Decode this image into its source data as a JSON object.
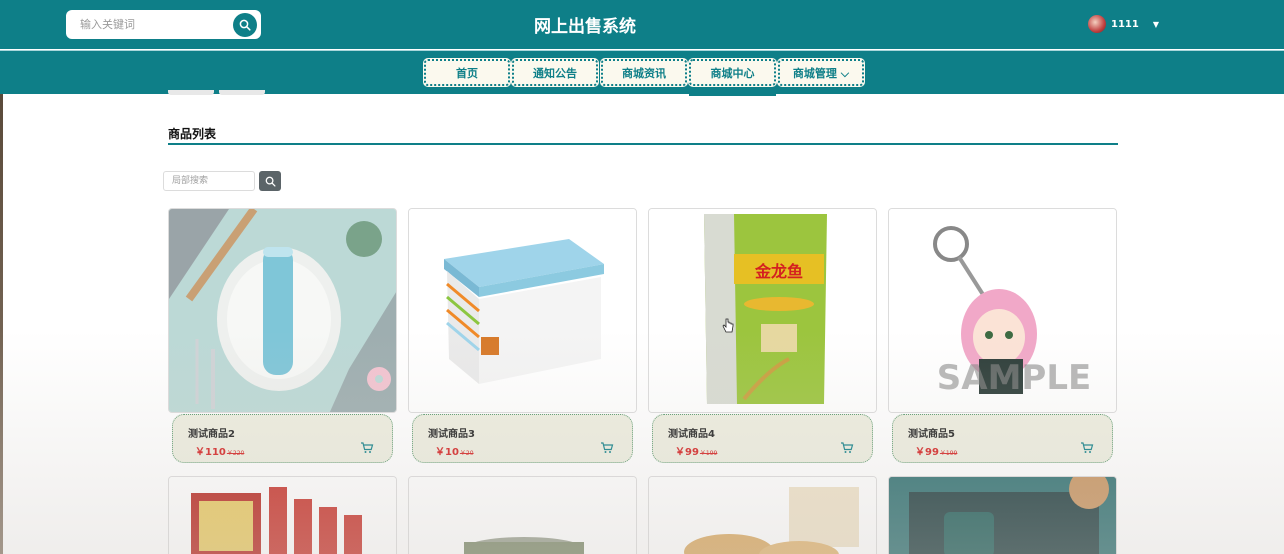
{
  "header": {
    "search_placeholder": "输入关键词",
    "site_title": "网上出售系统",
    "username": "1111"
  },
  "nav": {
    "items": [
      {
        "label": "首页"
      },
      {
        "label": "通知公告"
      },
      {
        "label": "商城资讯"
      },
      {
        "label": "商城中心"
      },
      {
        "label": "商城管理 ⌵"
      }
    ]
  },
  "section": {
    "title": "商品列表",
    "local_search_placeholder": "局部搜索"
  },
  "products": [
    {
      "name": "测试商品2",
      "price": "￥110",
      "old_price": "￥220"
    },
    {
      "name": "测试商品3",
      "price": "￥10",
      "old_price": "￥20"
    },
    {
      "name": "测试商品4",
      "price": "￥99",
      "old_price": "￥199"
    },
    {
      "name": "测试商品5",
      "price": "￥99",
      "old_price": "￥199"
    }
  ],
  "colors": {
    "brand": "#0e7f88",
    "price": "#d42020",
    "card_info_bg": "#eeeee0"
  },
  "icons": [
    "search-icon",
    "chevron-down-icon",
    "cart-icon"
  ]
}
